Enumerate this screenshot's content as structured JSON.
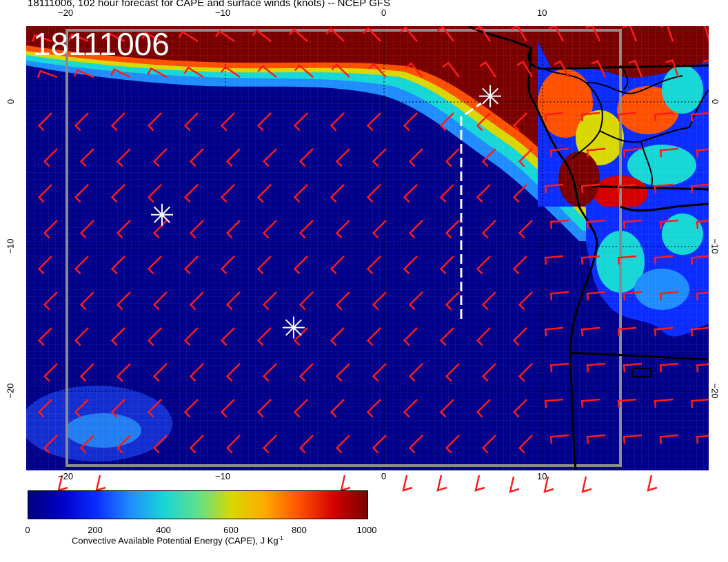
{
  "title": "18111006, 102 hour forecast for CAPE and surface winds (knots) -- NCEP GFS",
  "run_label": "18111006",
  "axis": {
    "top_ticks": [
      "−20",
      "−10",
      "0",
      "10"
    ],
    "bottom_ticks": [
      "−20",
      "−10",
      "0",
      "10"
    ],
    "left_ticks": [
      "0",
      "−10",
      "−20"
    ],
    "right_ticks": [
      "0",
      "−10",
      "−20"
    ]
  },
  "colorbar": {
    "ticks": [
      "0",
      "200",
      "400",
      "600",
      "800",
      "1000"
    ],
    "title_main": "Convective Available Potential Energy (CAPE), J Kg",
    "title_sup": "-1",
    "colors": [
      "#00007f",
      "#0000c8",
      "#0a2cff",
      "#1f8cff",
      "#17d6d6",
      "#5fe08c",
      "#d8d800",
      "#ffa800",
      "#ff5000",
      "#d40000",
      "#7a0000"
    ]
  },
  "markers": [
    {
      "name": "star-marker-1",
      "lon": -14.0,
      "lat": -7.8
    },
    {
      "name": "star-marker-2",
      "lon": -5.7,
      "lat": -15.6
    },
    {
      "name": "star-marker-3",
      "lon": 6.7,
      "lat": 0.4
    }
  ],
  "colors": {
    "wind_barb": "#ff1a1a",
    "low_cape": "#00007f",
    "high_cape": "#7a0000",
    "coast": "#000000",
    "track": "#ffffff"
  }
}
